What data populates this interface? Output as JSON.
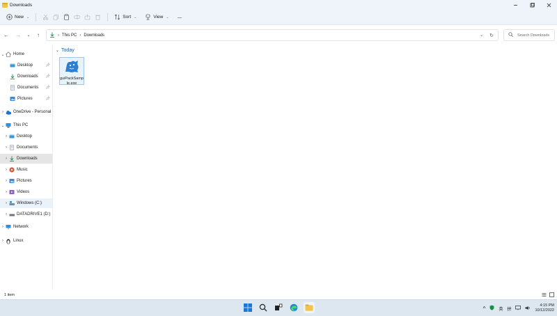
{
  "window": {
    "title": "Downloads"
  },
  "toolbar": {
    "new_label": "New",
    "sort_label": "Sort",
    "view_label": "View"
  },
  "address": {
    "crumbs": [
      "This PC",
      "Downloads"
    ]
  },
  "search": {
    "placeholder": "Search Downloads"
  },
  "sidebar": {
    "items": [
      {
        "label": "Home",
        "icon": "home-icon"
      },
      {
        "label": "Desktop",
        "icon": "desktop-folder-icon",
        "pinned": true
      },
      {
        "label": "Downloads",
        "icon": "download-icon",
        "pinned": true
      },
      {
        "label": "Documents",
        "icon": "documents-icon",
        "pinned": true
      },
      {
        "label": "Pictures",
        "icon": "pictures-icon",
        "pinned": true
      },
      {
        "label": "OneDrive - Personal",
        "icon": "onedrive-icon"
      },
      {
        "label": "This PC",
        "icon": "pc-icon"
      },
      {
        "label": "Desktop",
        "icon": "desktop-folder-icon"
      },
      {
        "label": "Documents",
        "icon": "documents-icon"
      },
      {
        "label": "Downloads",
        "icon": "download-icon",
        "selected": true
      },
      {
        "label": "Music",
        "icon": "music-icon"
      },
      {
        "label": "Pictures",
        "icon": "pictures-icon"
      },
      {
        "label": "Videos",
        "icon": "videos-icon"
      },
      {
        "label": "Windows  (C:)",
        "icon": "drive-icon"
      },
      {
        "label": "DATADRIVE1 (D:)",
        "icon": "drive-icon"
      },
      {
        "label": "Network",
        "icon": "network-icon"
      },
      {
        "label": "Linux",
        "icon": "linux-icon"
      }
    ]
  },
  "content": {
    "group_label": "Today",
    "files": [
      {
        "name": "guiPackSample.exe",
        "icon": "installer-icon"
      }
    ]
  },
  "status": {
    "item_count": "1 item"
  },
  "tray": {
    "ime_label": "英",
    "ime2_label": "拼",
    "time": "4:15 PM",
    "date": "10/12/2022"
  },
  "colors": {
    "accent": "#1a5e9c",
    "folder_yellow": "#f2c24b",
    "selection": "#e5e5e5"
  }
}
